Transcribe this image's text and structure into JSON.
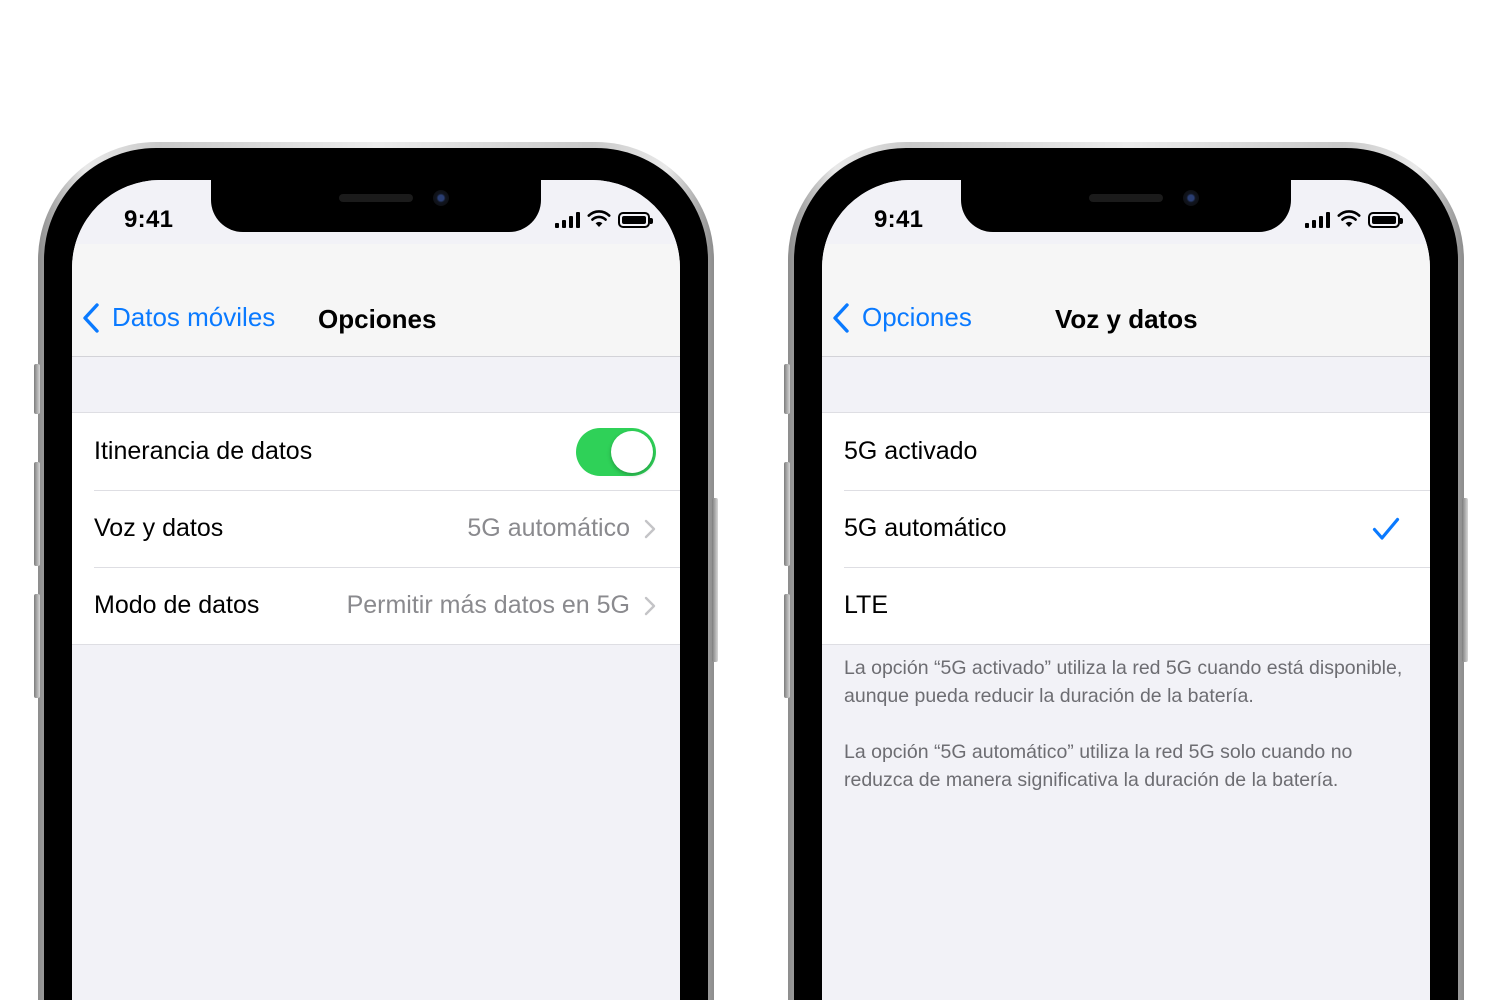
{
  "colors": {
    "accent": "#0a7aff",
    "toggle_on": "#2fd158",
    "secondary_text": "#8a8a8e",
    "group_background": "#f2f2f7"
  },
  "left_phone": {
    "status": {
      "time": "9:41",
      "icons": [
        "cellular-signal-icon",
        "wifi-icon",
        "battery-icon"
      ]
    },
    "nav": {
      "back_label": "Datos móviles",
      "title": "Opciones"
    },
    "rows": [
      {
        "label": "Itinerancia de datos",
        "control": "toggle",
        "toggle_on": true
      },
      {
        "label": "Voz y datos",
        "value": "5G automático",
        "accessory": "chevron-right-icon"
      },
      {
        "label": "Modo de datos",
        "value": "Permitir más datos en 5G",
        "accessory": "chevron-right-icon"
      }
    ]
  },
  "right_phone": {
    "status": {
      "time": "9:41",
      "icons": [
        "cellular-signal-icon",
        "wifi-icon",
        "battery-icon"
      ]
    },
    "nav": {
      "back_label": "Opciones",
      "title": "Voz y datos"
    },
    "rows": [
      {
        "label": "5G activado",
        "selected": false
      },
      {
        "label": "5G automático",
        "selected": true
      },
      {
        "label": "LTE",
        "selected": false
      }
    ],
    "footer": [
      "La opción “5G activado” utiliza la red 5G cuando está disponible, aunque pueda reducir la duración de la batería.",
      "La opción “5G automático” utiliza la red 5G solo cuando no reduzca de manera significativa la duración de la batería."
    ]
  }
}
